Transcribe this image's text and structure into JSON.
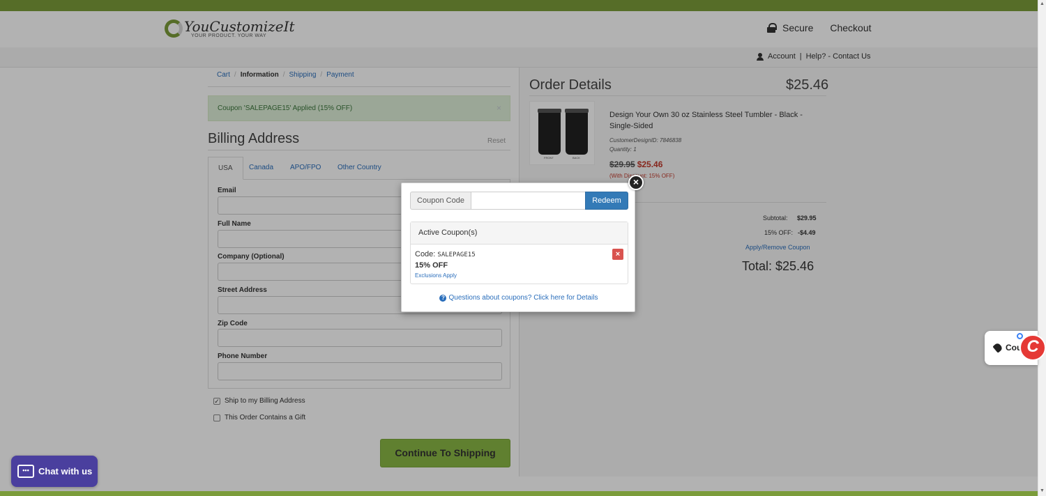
{
  "header": {
    "logo_text": "YouCustomizeIt",
    "logo_tagline": "YOUR PRODUCT. YOUR WAY",
    "secure_label": "Secure",
    "checkout_label": "Checkout"
  },
  "subnav": {
    "account_label": "Account",
    "separator": "|",
    "help_label": "Help? - Contact Us"
  },
  "breadcrumb": {
    "items": [
      "Cart",
      "Information",
      "Shipping",
      "Payment"
    ],
    "separator": "/"
  },
  "alert": {
    "text": "Coupon 'SALEPAGE15' Applied (15% OFF)",
    "close": "×"
  },
  "billing": {
    "title": "Billing Address",
    "reset_label": "Reset",
    "tabs": [
      "USA",
      "Canada",
      "APO/FPO",
      "Other Country"
    ],
    "fields": {
      "email": "Email",
      "full_name": "Full Name",
      "company": "Company (Optional)",
      "street": "Street Address",
      "zip": "Zip Code",
      "phone": "Phone Number"
    },
    "ship_to_billing": "Ship to my Billing Address",
    "gift": "This Order Contains a Gift",
    "continue_label": "Continue To Shipping"
  },
  "order": {
    "title": "Order Details",
    "total_header": "$25.46",
    "product_name": "Design Your Own 30 oz Stainless Steel Tumbler - Black - Single-Sided",
    "design_id": "CustomerDesignID: 7846838",
    "quantity": "Quantity: 1",
    "old_price": "$29.95",
    "new_price": "$25.46",
    "discount_note": "(With Discount: 15% OFF)",
    "thumb_captions": [
      "FRONT",
      "BACK"
    ],
    "subtotal_label": "Subtotal:",
    "subtotal_value": "$29.95",
    "discount_label": "15% OFF:",
    "discount_value": "-$4.49",
    "apply_remove_label": "Apply/Remove Coupon",
    "total_label": "Total: $25.46"
  },
  "modal": {
    "close": "×",
    "coupon_label": "Coupon Code",
    "coupon_value": "",
    "coupon_placeholder": "",
    "redeem_label": "Redeem",
    "active_title": "Active Coupon(s)",
    "code_prefix": "Code:",
    "code": "SALEPAGE15",
    "off_text": "15% OFF",
    "exclusions": "Exclusions Apply",
    "delete": "×",
    "question_icon": "?",
    "question_link": "Questions about coupons? Click here for Details"
  },
  "chat": {
    "label": "Chat with us",
    "icon": "chat-bubble-icon"
  },
  "coupon_widget": {
    "label": "Cou",
    "fab_glyph": "C"
  },
  "colors": {
    "brand_green": "#7b9c3a",
    "link_blue": "#2a6ebb",
    "redeem_blue": "#337ab7",
    "chat_purple": "#4a3f9e",
    "sale_red": "#c0392b"
  }
}
